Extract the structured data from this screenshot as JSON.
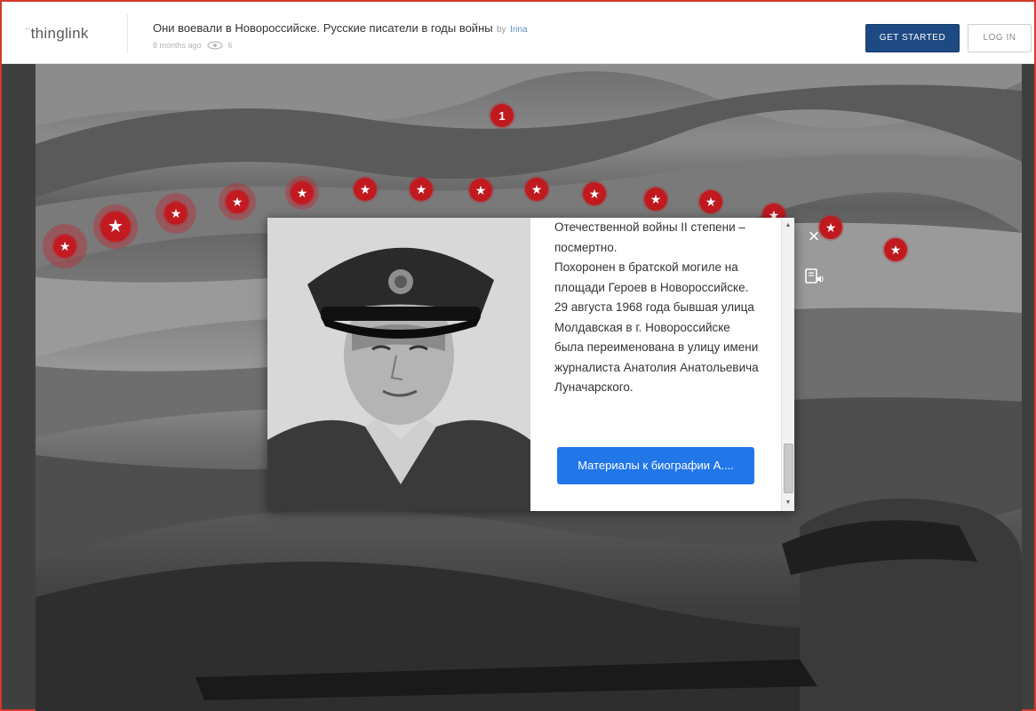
{
  "header": {
    "logo": "thinglink",
    "logo_mark": "··",
    "title": "Они воевали в Новороссийске. Русские писатели в годы войны",
    "by": "by",
    "author": "Irina",
    "age": "8 months ago",
    "views": "6",
    "get_started": "GET STARTED",
    "log_in": "LOG IN"
  },
  "hotspots": [
    {
      "icon": "number-1",
      "label": "1"
    },
    {
      "icon": "star-icon"
    },
    {
      "icon": "star-icon"
    },
    {
      "icon": "star-icon"
    },
    {
      "icon": "star-icon"
    },
    {
      "icon": "star-icon"
    },
    {
      "icon": "star-icon"
    },
    {
      "icon": "star-icon"
    },
    {
      "icon": "star-icon"
    },
    {
      "icon": "star-icon"
    },
    {
      "icon": "star-icon"
    },
    {
      "icon": "star-icon"
    },
    {
      "icon": "star-icon"
    },
    {
      "icon": "star-icon"
    },
    {
      "icon": "star-icon"
    },
    {
      "icon": "star-icon"
    }
  ],
  "modal": {
    "text": "Отечественной войны II степени – посмертно.\nПохоронен в братской могиле на площади Героев в Новороссийске.\n29 августа 1968 года бывшая улица Молдавская в г. Новороссийске была переименована в улицу имени журналиста Анатолия Анатольевича Луначарского.",
    "button": "Материалы к биографии А...."
  },
  "colors": {
    "hotspot": "#c01a1f",
    "primary_button": "#1e4a83",
    "modal_button": "#2176e8",
    "frame": "#d23a2a"
  }
}
